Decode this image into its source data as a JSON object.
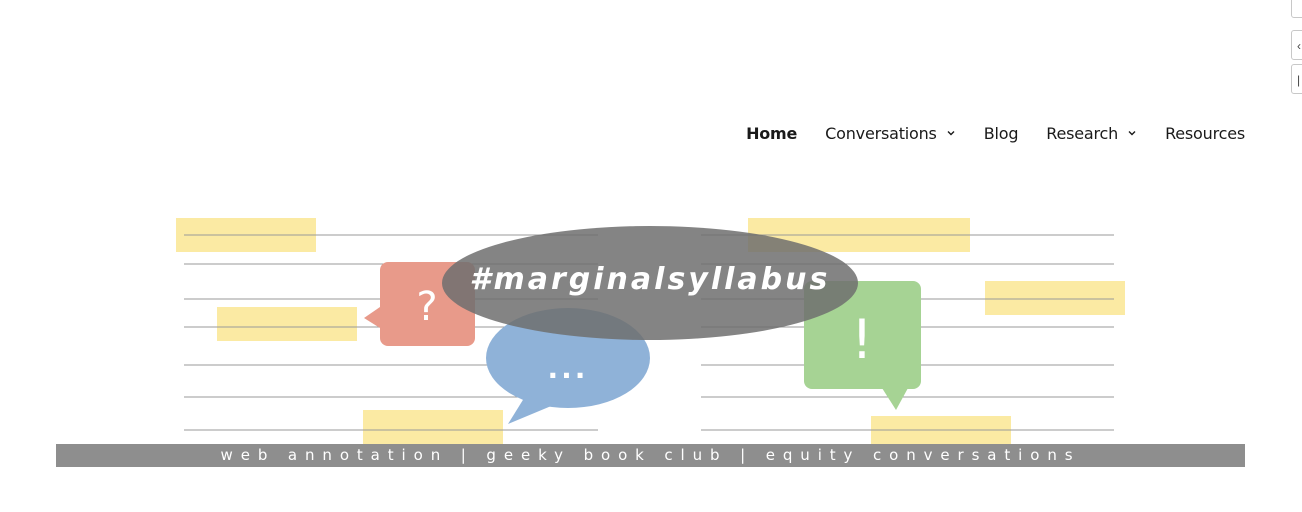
{
  "nav": {
    "items": [
      {
        "label": "Home",
        "active": true,
        "has_dropdown": false
      },
      {
        "label": "Conversations",
        "active": false,
        "has_dropdown": true
      },
      {
        "label": "Blog",
        "active": false,
        "has_dropdown": false
      },
      {
        "label": "Research",
        "active": false,
        "has_dropdown": true
      },
      {
        "label": "Resources",
        "active": false,
        "has_dropdown": false
      }
    ]
  },
  "banner": {
    "hashtag": "#marginalsyllabus",
    "tagline": "web annotation  |  geeky book club  |  equity conversations",
    "question_mark": "?",
    "ellipsis": "...",
    "exclamation": "!",
    "colors": {
      "highlight": "#fbeaa3",
      "question_bubble": "#e89a8a",
      "speech_bubble": "#8fb2d8",
      "exclaim_bubble": "#a6d394",
      "hashtag_ellipse": "#808080",
      "tagline_bar": "#8e8e8e",
      "rule_line": "#9a9a9a"
    }
  },
  "icons": {
    "dropdown": "chevron-down-icon"
  }
}
